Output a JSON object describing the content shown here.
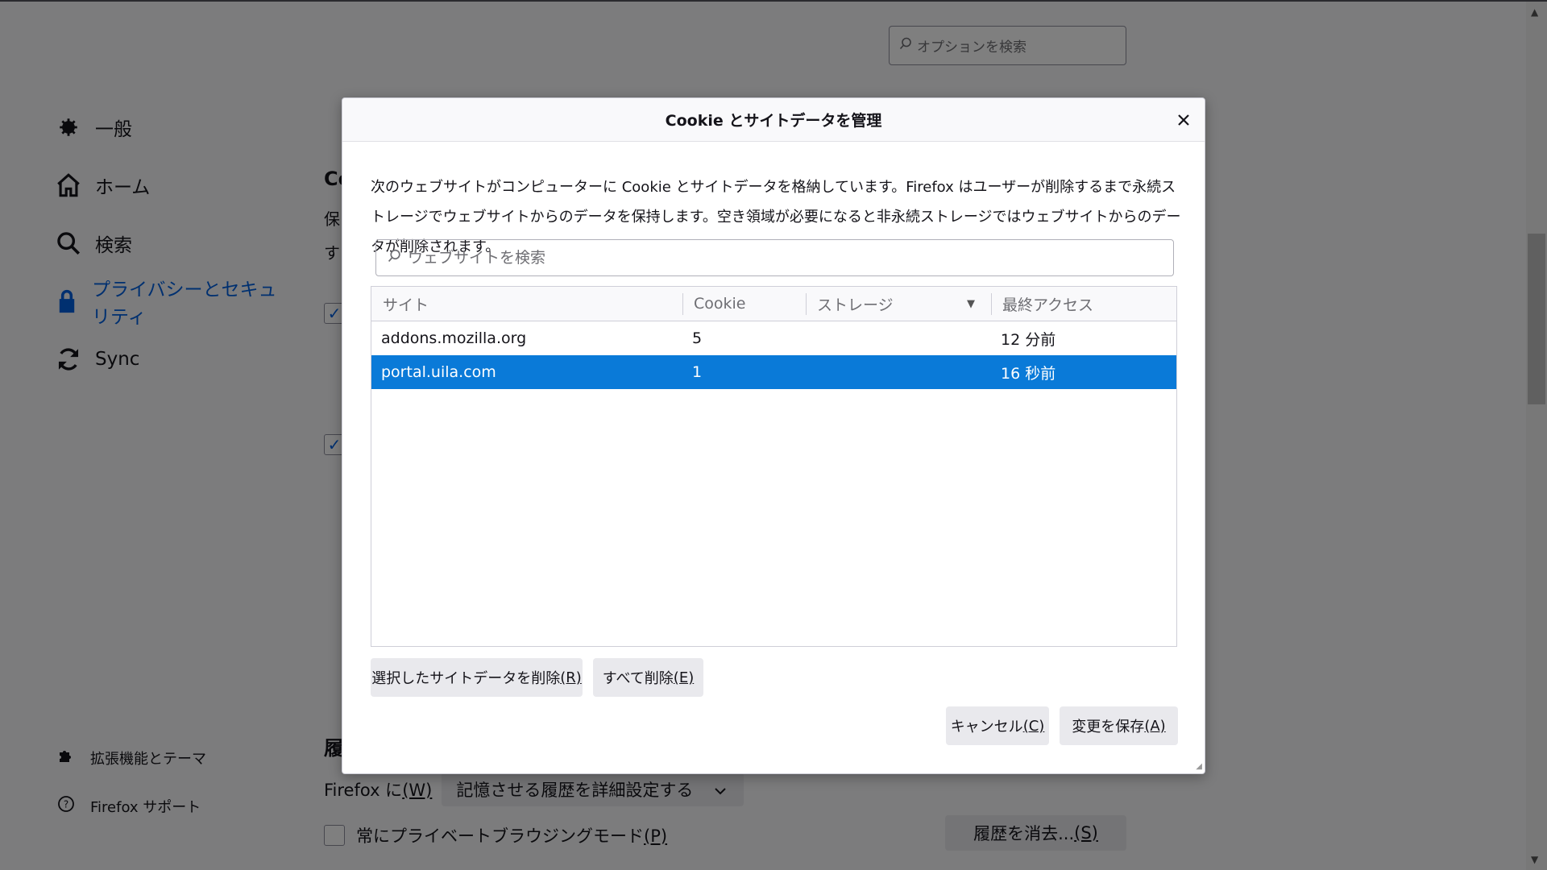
{
  "background": {
    "options_search_placeholder": "オプションを検索",
    "nav": [
      {
        "label": "一般",
        "icon": "gear-icon"
      },
      {
        "label": "ホーム",
        "icon": "home-icon"
      },
      {
        "label": "検索",
        "icon": "search-icon"
      },
      {
        "label": "プライバシーとセキュリティ",
        "icon": "lock-icon",
        "active": true
      },
      {
        "label": "Sync",
        "icon": "sync-icon"
      }
    ],
    "footer_links": [
      {
        "label": "拡張機能とテーマ",
        "icon": "puzzle-icon"
      },
      {
        "label": "Firefox サポート",
        "icon": "help-icon"
      }
    ],
    "peek": {
      "heading_char": "Co",
      "text_line1": "保",
      "text_line2": "す",
      "section_char": "履"
    },
    "history": {
      "firefox_label": "Firefox に",
      "firefox_accesskey": "(W)",
      "mode_value": "記憶させる履歴を詳細設定する",
      "private_label": "常にプライベートブラウジングモード",
      "private_accesskey": "(P)",
      "clear_label": "履歴を消去...",
      "clear_accesskey": "(S)"
    }
  },
  "dialog": {
    "title": "Cookie とサイトデータを管理",
    "description": "次のウェブサイトがコンピューターに Cookie とサイトデータを格納しています。Firefox はユーザーが削除するまで永続ストレージでウェブサイトからのデータを保持します。空き領域が必要になると非永続ストレージではウェブサイトからのデータが削除されます。",
    "search_placeholder": "ウェブサイトを検索",
    "columns": {
      "site": "サイト",
      "cookie": "Cookie",
      "storage": "ストレージ",
      "last_access": "最終アクセス"
    },
    "rows": [
      {
        "site": "addons.mozilla.org",
        "cookie": "5",
        "storage": "",
        "last_access": "12 分前",
        "selected": false
      },
      {
        "site": "portal.uila.com",
        "cookie": "1",
        "storage": "",
        "last_access": "16 秒前",
        "selected": true
      }
    ],
    "remove_selected_label": "選択したサイトデータを削除",
    "remove_selected_accesskey": "(R)",
    "remove_all_label": "すべて削除",
    "remove_all_accesskey": "(E)",
    "cancel_label": "キャンセル",
    "cancel_accesskey": "(C)",
    "save_label": "変更を保存",
    "save_accesskey": "(A)"
  },
  "colors": {
    "accent": "#0061e0",
    "selected_row": "#0a7ad8",
    "button_bg": "#e9e9ed"
  }
}
